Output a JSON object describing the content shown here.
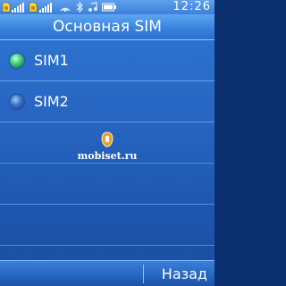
{
  "status_bar": {
    "time": "12:26",
    "icons": [
      "sim1-icon",
      "signal-icon",
      "sim2-icon",
      "signal-icon",
      "radio-icon",
      "bluetooth-icon",
      "music-icon",
      "battery-icon"
    ]
  },
  "title": "Основная SIM",
  "options": [
    {
      "label": "SIM1",
      "selected": true
    },
    {
      "label": "SIM2",
      "selected": false
    }
  ],
  "watermark": {
    "text": "mobiset.ru"
  },
  "softkeys": {
    "right": "Назад"
  },
  "colors": {
    "background": "#2868c4",
    "title_bar": "#3a84dd",
    "text": "#ffffff",
    "radio_selected": "#5ee08e"
  }
}
